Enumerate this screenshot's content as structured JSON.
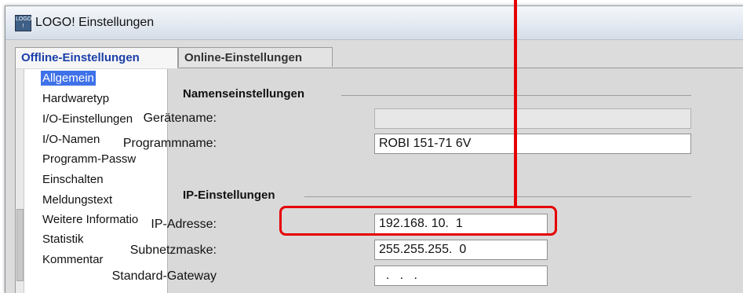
{
  "window": {
    "title": "LOGO! Einstellungen",
    "icon": "logo-app-icon",
    "icon_text": [
      "LOGO",
      "!"
    ]
  },
  "tabs": [
    {
      "label": "Offline-Einstellungen",
      "active": true
    },
    {
      "label": "Online-Einstellungen",
      "active": false
    }
  ],
  "nav": {
    "items": [
      {
        "label": "Allgemein",
        "selected": true
      },
      {
        "label": "Hardwaretyp"
      },
      {
        "label": "I/O-Einstellungen"
      },
      {
        "label": "I/O-Namen"
      },
      {
        "label": "Programm-Passw"
      },
      {
        "label": "Einschalten"
      },
      {
        "label": "Meldungstext"
      },
      {
        "label": "Weitere Informatio"
      },
      {
        "label": "Statistik"
      },
      {
        "label": "Kommentar"
      }
    ]
  },
  "name_settings": {
    "title": "Namenseinstellungen",
    "device_name_label": "Gerätename:",
    "device_name_value": "",
    "program_name_label": "Programmname:",
    "program_name_value": "ROBI 151-71 6V"
  },
  "ip_settings": {
    "title": "IP-Einstellungen",
    "ip_label": "IP-Adresse:",
    "ip_value": "192.168. 10.  1",
    "subnet_label": "Subnetzmaske:",
    "subnet_value": "255.255.255.  0",
    "gateway_label": "Standard-Gateway",
    "gateway_value": "  .   .   ."
  },
  "colors": {
    "highlight": "#e60000",
    "selected_nav": "#3f71e8",
    "active_tab_text": "#1a3ea8"
  }
}
